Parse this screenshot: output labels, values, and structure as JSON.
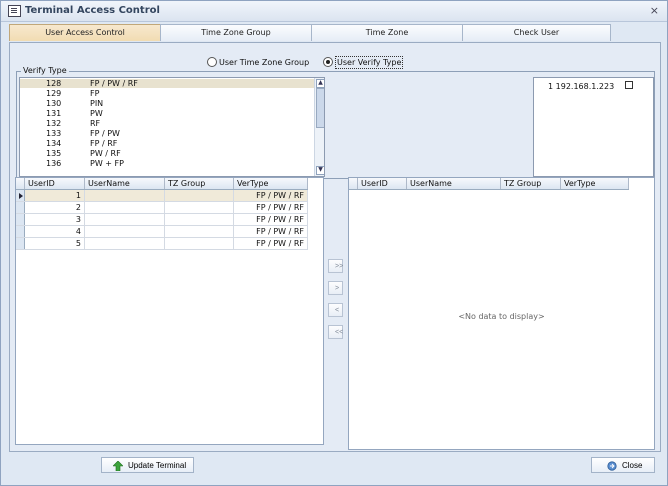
{
  "window": {
    "title": "Terminal Access Control",
    "close_glyph": "×"
  },
  "tabs": [
    {
      "label": "User Access Control",
      "active": true
    },
    {
      "label": "Time Zone Group",
      "active": false
    },
    {
      "label": "Time Zone",
      "active": false
    },
    {
      "label": "Check User",
      "active": false
    }
  ],
  "radio": {
    "option1": "User Time Zone Group",
    "option2": "User Verify Type",
    "selected": "User Verify Type"
  },
  "verify_type": {
    "legend": "Verify Type",
    "rows": [
      {
        "id": "128",
        "type": "FP / PW / RF",
        "selected": true
      },
      {
        "id": "129",
        "type": "FP",
        "selected": false
      },
      {
        "id": "130",
        "type": "PIN",
        "selected": false
      },
      {
        "id": "131",
        "type": "PW",
        "selected": false
      },
      {
        "id": "132",
        "type": "RF",
        "selected": false
      },
      {
        "id": "133",
        "type": "FP / PW",
        "selected": false
      },
      {
        "id": "134",
        "type": "FP / RF",
        "selected": false
      },
      {
        "id": "135",
        "type": "PW / RF",
        "selected": false
      },
      {
        "id": "136",
        "type": "PW + FP",
        "selected": false
      }
    ]
  },
  "terminal": {
    "label": "1 192.168.1.223",
    "checked": false
  },
  "left_grid": {
    "columns": [
      "UserID",
      "UserName",
      "TZ Group",
      "VerType"
    ],
    "rows": [
      {
        "user_id": "1",
        "user_name": "",
        "tz_group": "",
        "ver_type": "FP / PW / RF",
        "active": true
      },
      {
        "user_id": "2",
        "user_name": "",
        "tz_group": "",
        "ver_type": "FP / PW / RF",
        "active": false
      },
      {
        "user_id": "3",
        "user_name": "",
        "tz_group": "",
        "ver_type": "FP / PW / RF",
        "active": false
      },
      {
        "user_id": "4",
        "user_name": "",
        "tz_group": "",
        "ver_type": "FP / PW / RF",
        "active": false
      },
      {
        "user_id": "5",
        "user_name": "",
        "tz_group": "",
        "ver_type": "FP / PW / RF",
        "active": false
      }
    ]
  },
  "right_grid": {
    "columns": [
      "UserID",
      "UserName",
      "TZ Group",
      "VerType"
    ],
    "empty_text": "<No data to display>"
  },
  "move_buttons": [
    ">>",
    ">",
    "<",
    "<<"
  ],
  "footer": {
    "update_label": "Update Terminal",
    "close_label": "Close"
  },
  "icons": {
    "title": "window-list-icon",
    "update": "green-up-arrow-icon",
    "close": "blue-circle-arrow-icon"
  },
  "colors": {
    "accent": "#f1dcb2",
    "selection": "#e8e2cf",
    "border": "#94a6bf"
  }
}
